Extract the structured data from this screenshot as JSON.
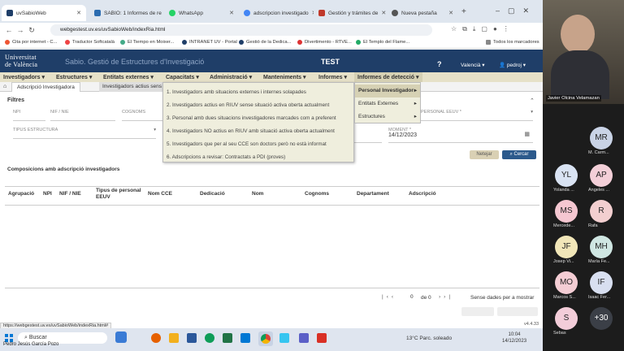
{
  "browser": {
    "tabs": [
      {
        "label": "uvSabioWeb",
        "color": "#1f3e68"
      },
      {
        "label": "SABIO: 1 Informes de re",
        "color": "#2b6cb0"
      },
      {
        "label": "WhatsApp",
        "color": "#25d366"
      },
      {
        "label": "adscripcion investigado",
        "color": "#4285f4"
      },
      {
        "label": "Gestión y trámites de",
        "color": "#c0392b"
      },
      {
        "label": "Nueva pestaña",
        "color": "#555"
      }
    ],
    "url": "webgestest.uv.es/uvSabioWeb/indexRia.html",
    "bookmarks": [
      "Cita por internet - C...",
      "Traductor Softcatalà",
      "El Tiempo en Moixer...",
      "INTRANET UV - Portal",
      "Gestió de la Dedica...",
      "Divertimento - RTVE...",
      "El Templo del Flame...",
      "Todos los marcadores"
    ],
    "status_url": "https://webgestest.uv.es/uvSabioWeb/indexRia.html#"
  },
  "app": {
    "logo_line1": "Universitat",
    "logo_line2": "de València",
    "title": "Sabio. Gestió de Estructures d'Investigació",
    "env": "TEST",
    "help": "?",
    "language": "Valencià",
    "user": "pedroj",
    "menu": [
      "Investigadors",
      "Estructures",
      "Entitats externes",
      "Capacitats",
      "Administració",
      "Manteniments",
      "Informes",
      "Informes de detecció"
    ],
    "subtabs": [
      "Adscripció Investigadora",
      "Investigadors actius sens"
    ],
    "filters_title": "Filtres",
    "fields": {
      "npi": "NPI",
      "nif": "NIF / NIE",
      "cognoms": "COGNOMS",
      "personal": "PERSONAL EEUV *",
      "tipus": "TIPUS ESTRUCTURA",
      "moment": "MOMENT *",
      "moment_value": "14/12/2023"
    },
    "buttons": {
      "clear": "Netejar",
      "search": "Cercar"
    },
    "section_title": "Composicions amb adscripció investigadors",
    "columns": [
      "Agrupació",
      "NPI",
      "NIF / NIE",
      "Tipus de personal EEUV",
      "Nom CCE",
      "Dedicació",
      "Nom",
      "Cognoms",
      "Departament",
      "Adscripció"
    ],
    "pager": {
      "page": "0",
      "of": "de 0",
      "empty": "Sense dades per a mostrar"
    },
    "version": "v4.4.33",
    "dropdown": [
      "1. Investigadors amb situacions externes i internes solapades",
      "2. Investigadors actius en RIUV sense situació activa oberta actualment",
      "3. Personal amb dues situacions investigadores marcades com a preferent",
      "4. Investigadors NO actius en RIUV amb situació activa oberta actualment",
      "5. Investigadors que per al seu CCE son doctors però no està informat",
      "6. Adscripcions a revisar: Contractats a PDI (proves)"
    ],
    "submenu": [
      "Personal Investigador",
      "Entitats Externes",
      "Estructures"
    ]
  },
  "taskbar": {
    "search": "Buscar",
    "weather": "13°C Parc. soleado",
    "time": "10:04",
    "date": "14/12/2023",
    "caption": "Pedro Jesús García Pozo"
  },
  "video": {
    "speaker": "Javier Olcina Velamazan",
    "participants": [
      {
        "initials": "MR",
        "name": "M. Carm...",
        "color": "#c9d3e6"
      },
      {
        "initials": "YL",
        "name": "Yolanda ...",
        "color": "#d9e3f3"
      },
      {
        "initials": "AP",
        "name": "Angeles ...",
        "color": "#f3cfd8"
      },
      {
        "initials": "MS",
        "name": "Mercede...",
        "color": "#f5c7d1"
      },
      {
        "initials": "R",
        "name": "Rafa",
        "color": "#f3cfd0"
      },
      {
        "initials": "JF",
        "name": "Josep Vi...",
        "color": "#f1e6b8"
      },
      {
        "initials": "MH",
        "name": "María Fe...",
        "color": "#cfe6e2"
      },
      {
        "initials": "MO",
        "name": "Marcos S...",
        "color": "#f4cdd4"
      },
      {
        "initials": "IF",
        "name": "Isaac Fer...",
        "color": "#d8dff0"
      },
      {
        "initials": "S",
        "name": "Sebas",
        "color": "#f3cdd9"
      }
    ],
    "more": "+30"
  }
}
